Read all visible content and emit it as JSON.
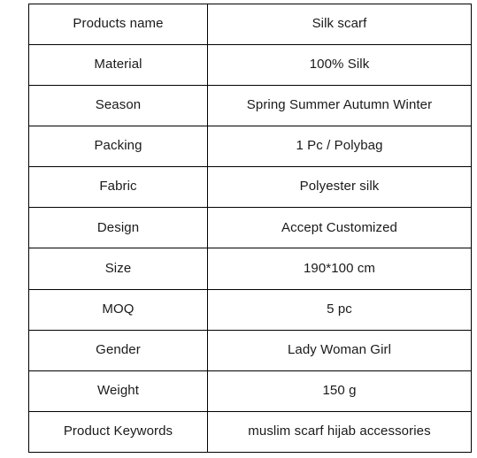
{
  "document": {
    "type": "product-specification-table",
    "background_color": "#ffffff",
    "border_color": "#000000",
    "text_color": "#1a1a1a"
  },
  "table": {
    "columns": [
      "attribute",
      "value"
    ],
    "rows": [
      {
        "attribute": "Products name",
        "value": "Silk scarf"
      },
      {
        "attribute": "Material",
        "value": "100% Silk"
      },
      {
        "attribute": "Season",
        "value": "Spring Summer Autumn Winter"
      },
      {
        "attribute": "Packing",
        "value": "1 Pc / Polybag"
      },
      {
        "attribute": "Fabric",
        "value": "Polyester silk"
      },
      {
        "attribute": "Design",
        "value": "Accept Customized"
      },
      {
        "attribute": "Size",
        "value": "190*100 cm"
      },
      {
        "attribute": "MOQ",
        "value": "5 pc"
      },
      {
        "attribute": "Gender",
        "value": "Lady Woman Girl"
      },
      {
        "attribute": "Weight",
        "value": "150 g"
      },
      {
        "attribute": "Product Keywords",
        "value": "muslim scarf hijab accessories"
      }
    ]
  }
}
